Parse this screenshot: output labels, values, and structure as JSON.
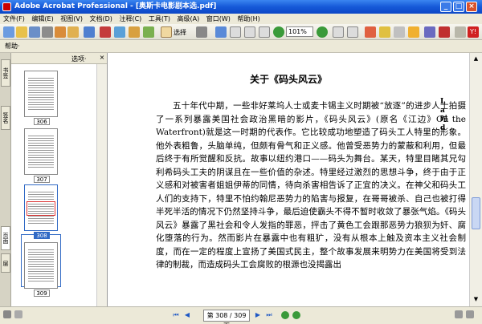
{
  "window": {
    "title": "Adobe Acrobat Professional - [奥斯卡电影剧本选.pdf]",
    "min": "_",
    "max": "□",
    "close": "×"
  },
  "menu": [
    "文件(F)",
    "编辑(E)",
    "视图(V)",
    "文档(D)",
    "注释(C)",
    "工具(T)",
    "高级(A)",
    "窗口(W)",
    "帮助(H)"
  ],
  "toolbar": {
    "select_label": "选择",
    "zoom_value": "101%"
  },
  "toolbar2": {
    "help_label": "帮助·"
  },
  "left_tabs": [
    "书签",
    "签名",
    "页面",
    "层"
  ],
  "panel": {
    "options_label": "选项·",
    "close": "×",
    "thumbnails": [
      {
        "page": "306"
      },
      {
        "page": "307"
      },
      {
        "page": "308",
        "selected": true
      },
      {
        "page": "309"
      }
    ]
  },
  "document": {
    "title": "关于《码头风云》",
    "paragraph": "五十年代中期，一些非好莱坞人士或麦卡锡主义时期被“放逐”的进步人士拍摄了一系列暴露美国社会政治黑暗的影片，《码头风云》(原名《江边》On the Waterfront)就是这一时期的代表作。它比较成功地塑造了码头工人特里的形象。他外表粗鲁，头脑单纯，但颇有骨气和正义感。他曾受恶势力的蒙蔽和利用，但最后终于有所觉醒和反抗。故事以纽约港口——码头为舞台。某天，特里目睹其兄勾利希码头工夫的阴谋且在一些价值的杂述。特里经过激烈的思想斗争，终于由于正义感和对被害者姐姐伊蒂的同情，待向杀害相告诉了正宜的决义。在神父和码头工人们的支持下，特里不怕约翰尼恶势力的陷害与报复，在哥哥被杀、自己也被打得半死半活的情况下仍然坚持斗争，最后迫使霸头不得不暂时收敛了暴张气焰。《码头风云》暴露了黑社会和令人发指的罪恶，抨击了黄色工会跟那恶势力狼狈为奸、腐化堕落的行为。然而影片在暴露中也有粗犷，没有从根本上触及资本主义社会制度，而在一定的程度上宣扬了美国式民主，整个故事发展来明势力在美国将受到法律的制裁，而造成码头工会腐败的根源也没揭露出",
    "stamp": "L a 时 d"
  },
  "status": {
    "page_display": "第 308 / 309 页"
  }
}
